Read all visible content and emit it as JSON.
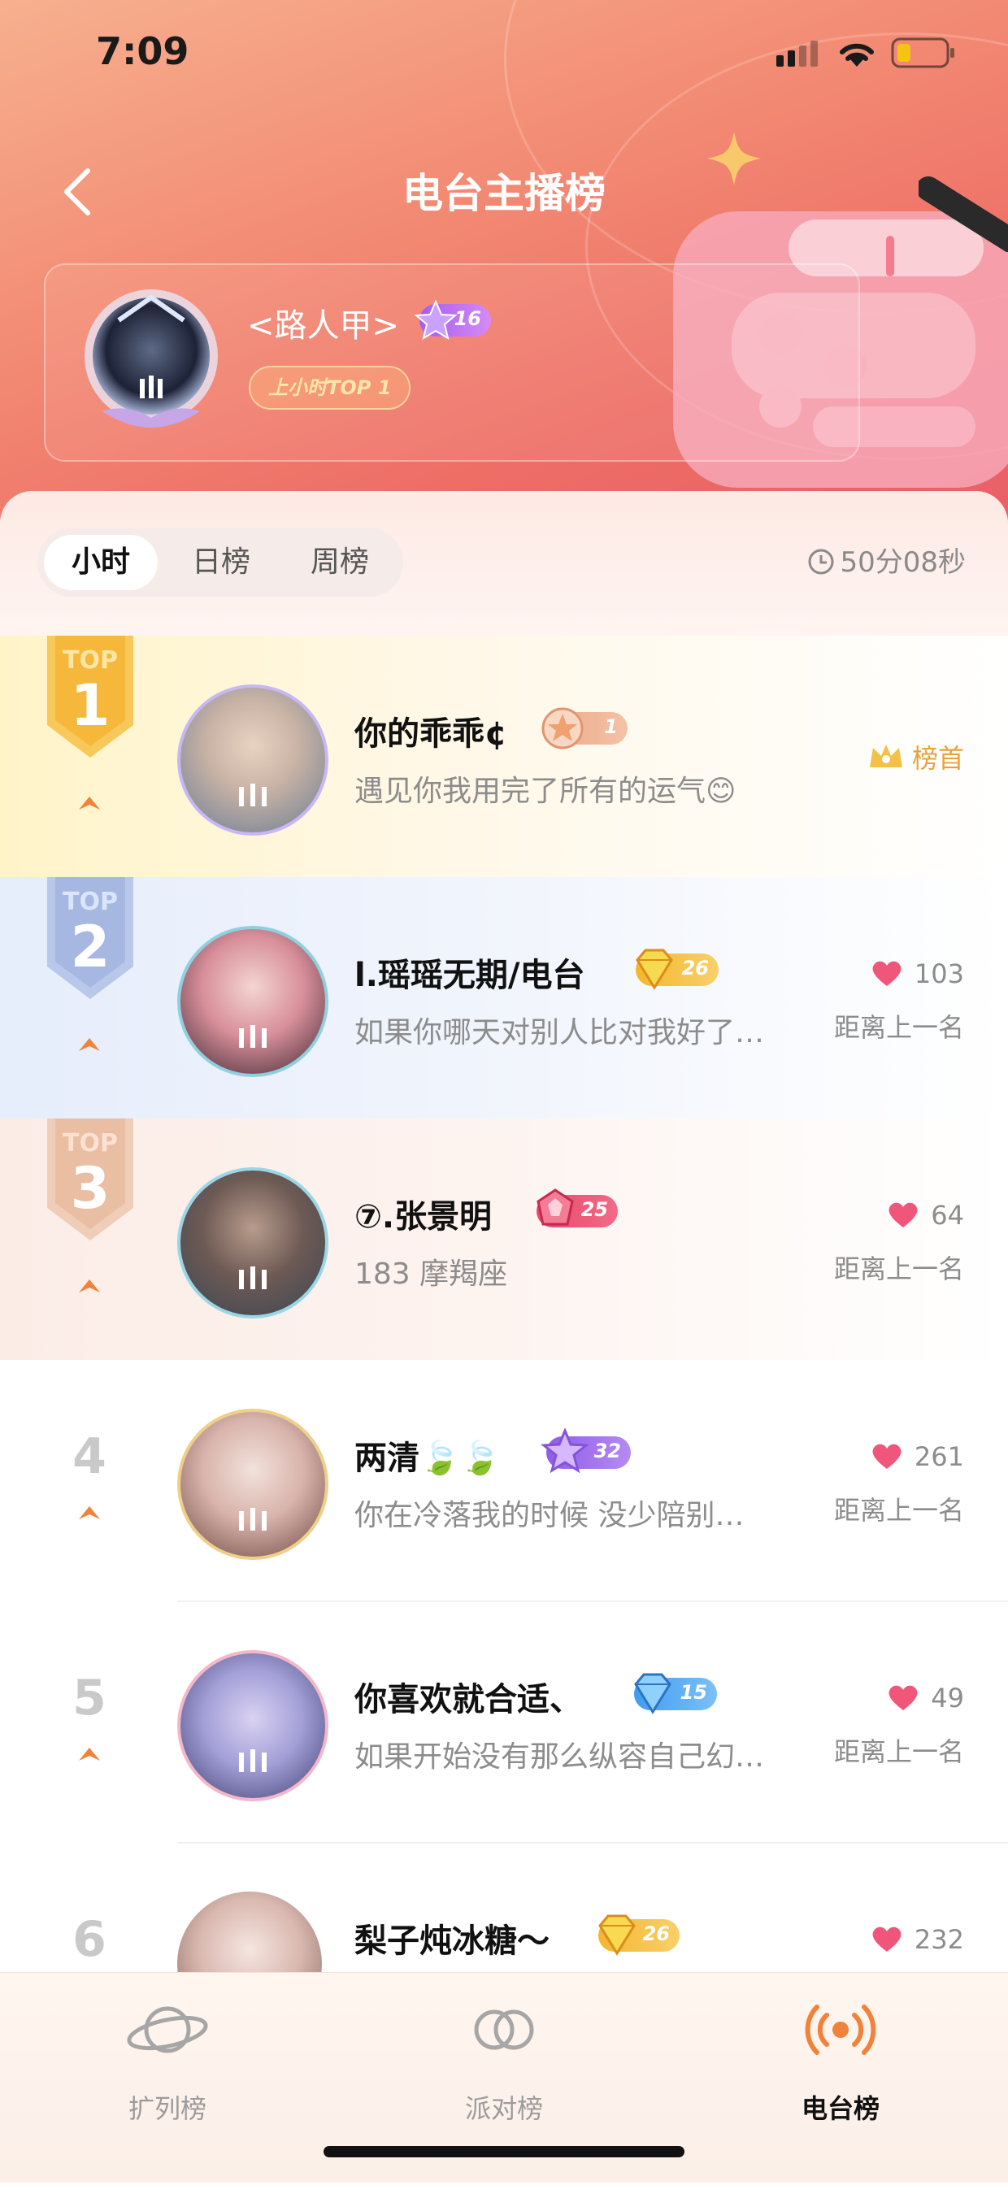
{
  "status_bar": {
    "time": "7:09"
  },
  "header": {
    "title": "电台主播榜",
    "top_card": {
      "name": "<路人甲>",
      "level": "16",
      "badge": "上小时TOP 1"
    }
  },
  "period_tabs": [
    {
      "label": "小时",
      "active": true
    },
    {
      "label": "日榜",
      "active": false
    },
    {
      "label": "周榜",
      "active": false
    }
  ],
  "countdown": "50分08秒",
  "top_label": "TOP",
  "rows": [
    {
      "rank": "1",
      "name": "你的乖乖¢",
      "level": "1",
      "subtitle": "遇见你我用完了所有的运气😊",
      "right_label": "榜首",
      "score": "",
      "gap_label": ""
    },
    {
      "rank": "2",
      "name": "l.瑶瑶无期/电台",
      "level": "26",
      "subtitle": "如果你哪天对别人比对我好了…",
      "score": "103",
      "gap_label": "距离上一名"
    },
    {
      "rank": "3",
      "name": "⑦.张景明",
      "level": "25",
      "subtitle": "183 摩羯座",
      "score": "64",
      "gap_label": "距离上一名"
    },
    {
      "rank": "4",
      "name": "两清🍃🍃",
      "level": "32",
      "subtitle": "你在冷落我的时候 没少陪别…",
      "score": "261",
      "gap_label": "距离上一名"
    },
    {
      "rank": "5",
      "name": "你喜欢就合适、",
      "level": "15",
      "subtitle": "如果开始没有那么纵容自己幻…",
      "score": "49",
      "gap_label": "距离上一名"
    },
    {
      "rank": "6",
      "name": "梨子炖冰糖～",
      "level": "26",
      "subtitle": "",
      "score": "232",
      "gap_label": ""
    }
  ],
  "bottom_nav": [
    {
      "label": "扩列榜",
      "icon": "planet-icon",
      "active": false
    },
    {
      "label": "派对榜",
      "icon": "rings-icon",
      "active": false
    },
    {
      "label": "电台榜",
      "icon": "radio-icon",
      "active": true
    }
  ],
  "colors": {
    "accent": "#f0823a",
    "heart": "#f0567a",
    "gold": "#f3b83e"
  }
}
